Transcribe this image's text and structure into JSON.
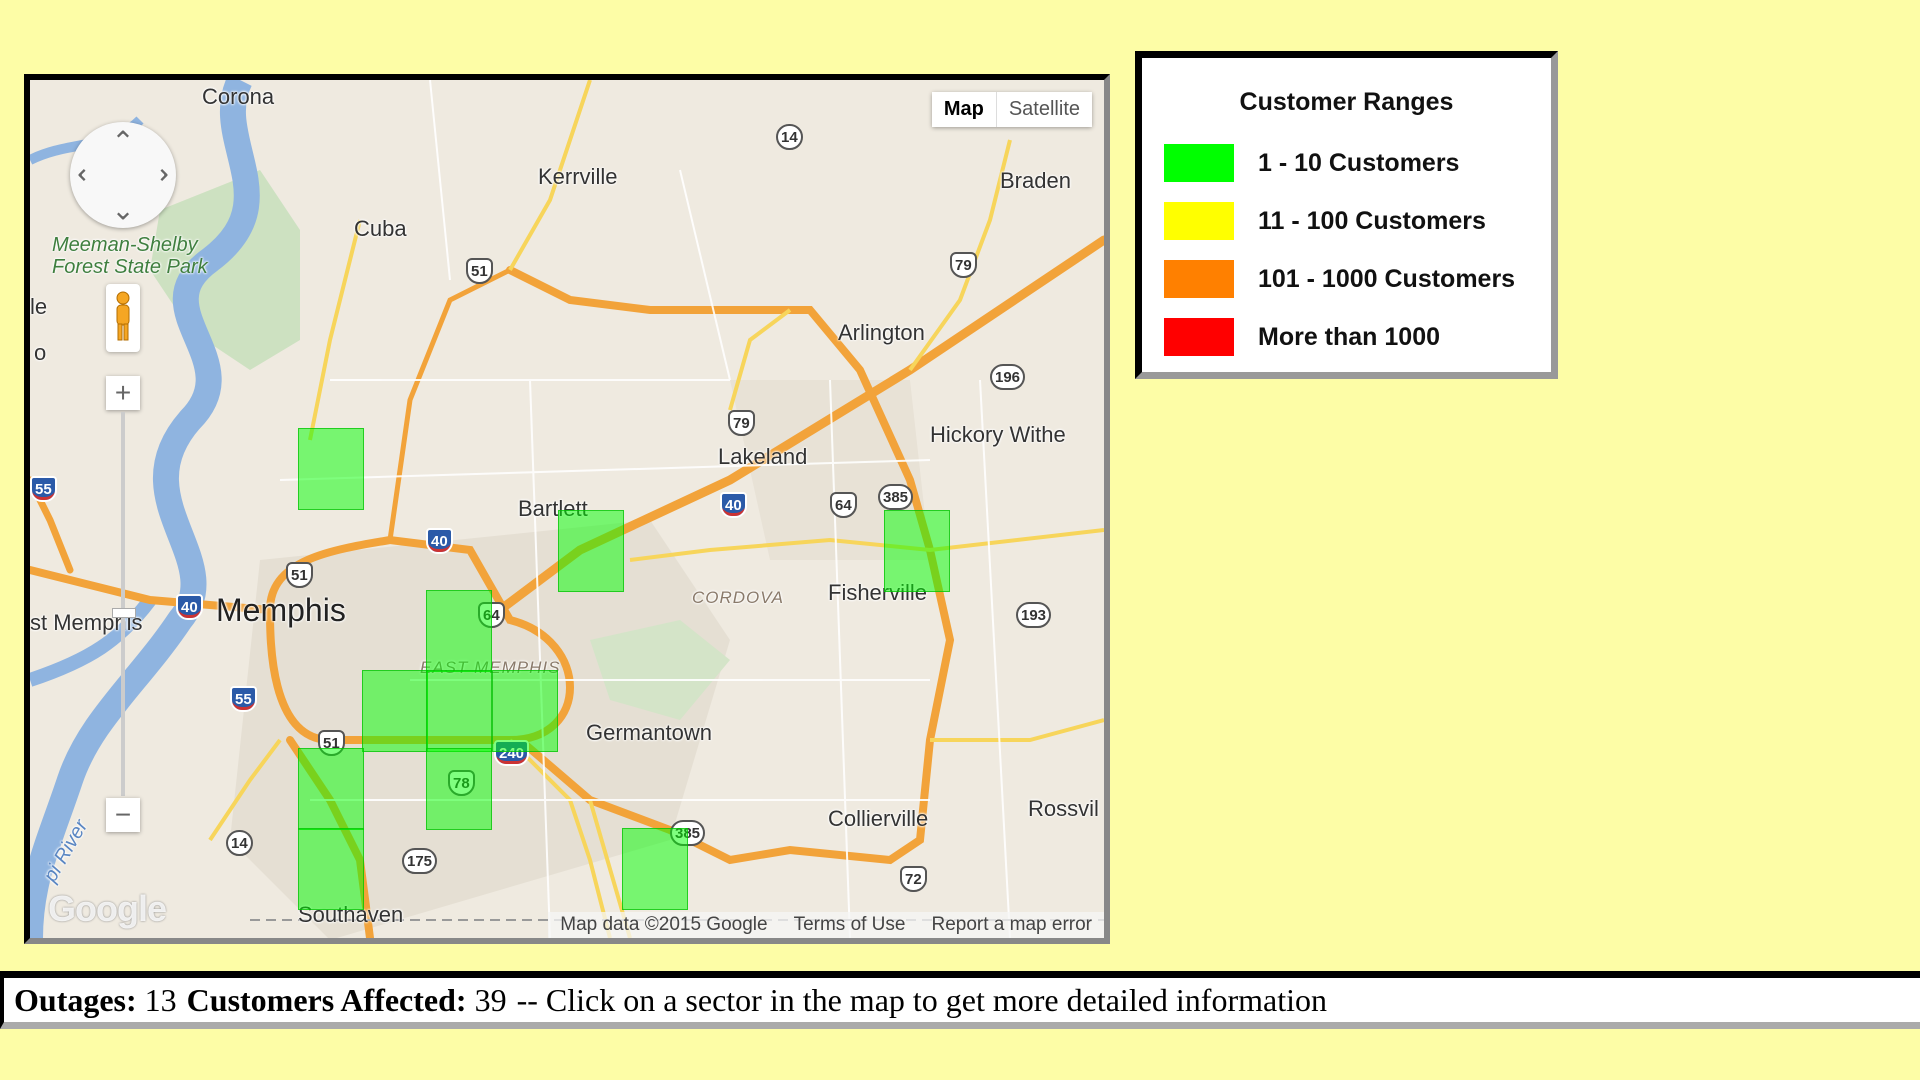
{
  "map": {
    "type_buttons": [
      {
        "label": "Map",
        "active": true
      },
      {
        "label": "Satellite",
        "active": false
      }
    ],
    "places": [
      {
        "name": "Corona",
        "kind": "town"
      },
      {
        "name": "Kerrville",
        "kind": "town"
      },
      {
        "name": "Braden",
        "kind": "town"
      },
      {
        "name": "Cuba",
        "kind": "town"
      },
      {
        "name": "Meeman-Shelby\nForest State Park",
        "kind": "park"
      },
      {
        "name": "Arlington",
        "kind": "town"
      },
      {
        "name": "Hickory Withe",
        "kind": "town"
      },
      {
        "name": "Lakeland",
        "kind": "town"
      },
      {
        "name": "Bartlett",
        "kind": "town"
      },
      {
        "name": "Memphis",
        "kind": "city"
      },
      {
        "name": "CORDOVA",
        "kind": "district"
      },
      {
        "name": "Fisherville",
        "kind": "town"
      },
      {
        "name": "EAST MEMPHIS",
        "kind": "district"
      },
      {
        "name": "Germantown",
        "kind": "town"
      },
      {
        "name": "Collierville",
        "kind": "town"
      },
      {
        "name": "Rossvil",
        "kind": "town"
      },
      {
        "name": "Southaven",
        "kind": "town"
      },
      {
        "name": "st Memphis",
        "kind": "town"
      },
      {
        "name": "le",
        "kind": "town"
      },
      {
        "name": "o",
        "kind": "town"
      },
      {
        "name": "pi River",
        "kind": "water"
      }
    ],
    "shields": [
      {
        "label": "14",
        "kind": "state"
      },
      {
        "label": "51",
        "kind": "us"
      },
      {
        "label": "79",
        "kind": "us"
      },
      {
        "label": "196",
        "kind": "state"
      },
      {
        "label": "79",
        "kind": "us"
      },
      {
        "label": "40",
        "kind": "interstate"
      },
      {
        "label": "64",
        "kind": "us"
      },
      {
        "label": "385",
        "kind": "state"
      },
      {
        "label": "40",
        "kind": "interstate"
      },
      {
        "label": "51",
        "kind": "us"
      },
      {
        "label": "40",
        "kind": "interstate"
      },
      {
        "label": "64",
        "kind": "us"
      },
      {
        "label": "193",
        "kind": "state"
      },
      {
        "label": "55",
        "kind": "interstate"
      },
      {
        "label": "51",
        "kind": "us"
      },
      {
        "label": "240",
        "kind": "interstate"
      },
      {
        "label": "78",
        "kind": "us"
      },
      {
        "label": "385",
        "kind": "state"
      },
      {
        "label": "14",
        "kind": "state"
      },
      {
        "label": "175",
        "kind": "state"
      },
      {
        "label": "72",
        "kind": "us"
      },
      {
        "label": "55",
        "kind": "interstate"
      }
    ],
    "sector_count": 12,
    "footer": {
      "map_data": "Map data ©2015 Google",
      "terms": "Terms of Use",
      "report": "Report a map error"
    },
    "logo": "Google",
    "controls": {
      "zoom_in": "+",
      "zoom_out": "−"
    }
  },
  "legend": {
    "title": "Customer Ranges",
    "items": [
      {
        "label": "1 - 10 Customers",
        "color": "#00ff00"
      },
      {
        "label": "11 - 100 Customers",
        "color": "#ffff00"
      },
      {
        "label": "101 - 1000 Customers",
        "color": "#ff8000"
      },
      {
        "label": "More than 1000",
        "color": "#ff0000"
      }
    ]
  },
  "status": {
    "outages_label": "Outages:",
    "outages_value": "13",
    "customers_label": "Customers Affected:",
    "customers_value": "39",
    "message": "-- Click on a sector in the map to get more detailed information"
  },
  "colors": {
    "page_bg": "#fdfda6",
    "sector_fill": "#00ff00",
    "highway": "#f2a33a",
    "water": "#8fb4e0"
  }
}
